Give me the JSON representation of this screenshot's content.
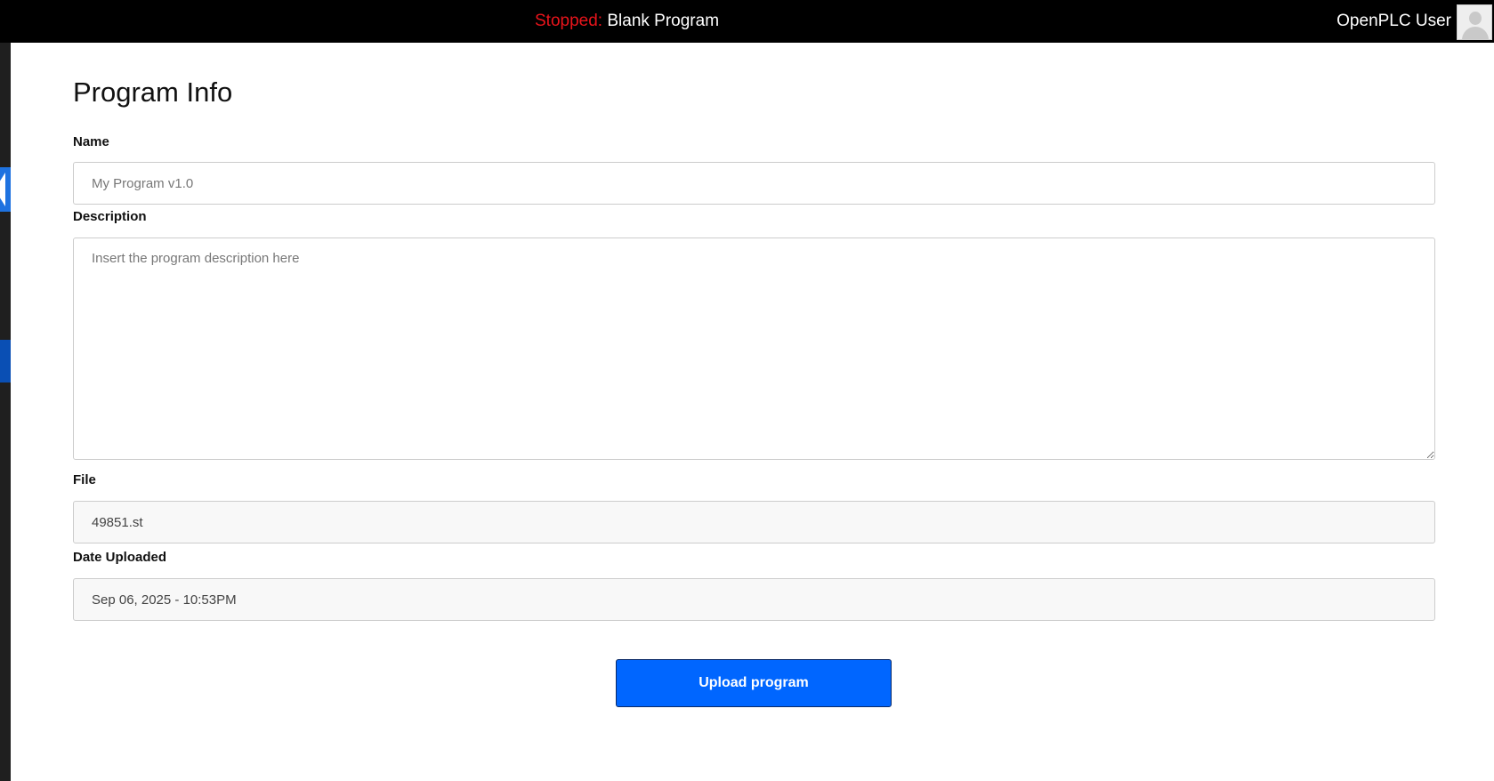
{
  "topbar": {
    "status_label": "Stopped:",
    "program_name": "Blank Program",
    "user_name": "OpenPLC User",
    "status_color": "#e8141b",
    "avatar_icon": "user-avatar-icon"
  },
  "sidebar": {
    "toggle_icon": "chevron-left-icon",
    "accent_color": "#1e72e0"
  },
  "page": {
    "title": "Program Info"
  },
  "form": {
    "name": {
      "label": "Name",
      "value": "",
      "placeholder": "My Program v1.0"
    },
    "description": {
      "label": "Description",
      "value": "",
      "placeholder": "Insert the program description here"
    },
    "file": {
      "label": "File",
      "value": "49851.st"
    },
    "date_uploaded": {
      "label": "Date Uploaded",
      "value": "Sep 06, 2025 - 10:53PM"
    },
    "submit_label": "Upload program",
    "button_color": "#0066ff"
  }
}
